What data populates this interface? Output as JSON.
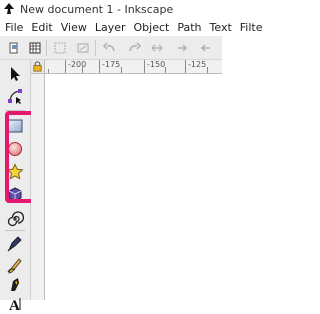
{
  "window": {
    "title": "New document 1 - Inkscape",
    "logo_icon": "inkscape-logo-icon"
  },
  "menu": [
    "File",
    "Edit",
    "View",
    "Layer",
    "Object",
    "Path",
    "Text",
    "Filte"
  ],
  "commandbar": {
    "icons": [
      "document-properties-icon",
      "grid-icon",
      "selection-resize-icon",
      "fit-drawing-icon",
      "undo-arrow-icon",
      "redo-arrow-icon",
      "flip-icon",
      "arrow-icon"
    ]
  },
  "ruler": {
    "labels": [
      "-200",
      "-175",
      "-150",
      "-125"
    ],
    "lock_icon": "lock-icon"
  },
  "toolbox": {
    "tools": [
      "selector-icon",
      "node-editor-icon",
      "rectangle-icon",
      "ellipse-icon",
      "star-icon",
      "3d-box-icon",
      "spiral-icon",
      "pen-icon",
      "pencil-icon",
      "calligraphy-icon",
      "text-icon"
    ]
  },
  "colors": {
    "highlight": "#e4186c",
    "toolbar_bg": "#ececec"
  }
}
